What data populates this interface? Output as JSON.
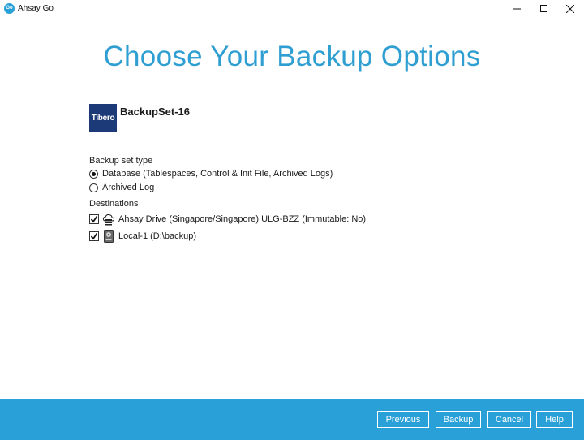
{
  "window": {
    "title": "Ahsay Go",
    "logo_text": "Go"
  },
  "main": {
    "heading": "Choose Your Backup Options",
    "backup_set": {
      "logo_text": "Tibero",
      "name": "BackupSet-16"
    },
    "backup_set_type": {
      "label": "Backup set type",
      "options": [
        {
          "label": "Database (Tablespaces, Control & Init File, Archived Logs)",
          "selected": true
        },
        {
          "label": "Archived Log",
          "selected": false
        }
      ]
    },
    "destinations": {
      "label": "Destinations",
      "items": [
        {
          "label": "Ahsay Drive (Singapore/Singapore) ULG-BZZ (Immutable: No)",
          "checked": true,
          "icon": "cloud-drive-icon"
        },
        {
          "label": "Local-1 (D:\\backup)",
          "checked": true,
          "icon": "local-drive-icon"
        }
      ]
    }
  },
  "footer": {
    "previous": "Previous",
    "backup": "Backup",
    "cancel": "Cancel",
    "help": "Help"
  },
  "colors": {
    "accent": "#2aa0d8",
    "heading": "#2f9fd2",
    "logo_bg": "#1c3a78"
  }
}
